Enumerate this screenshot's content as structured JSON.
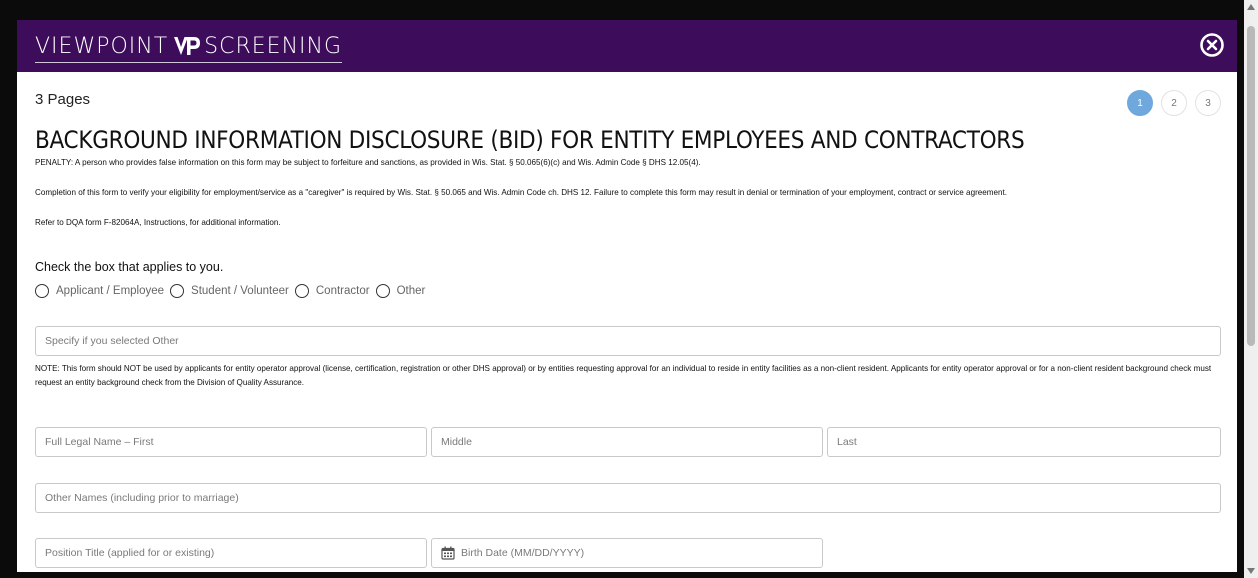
{
  "header": {
    "brand_left": "VIEWPOINT",
    "brand_right": "SCREENING",
    "logo_icon": "vp-logo-icon",
    "close_icon": "close-circle-icon",
    "colors": {
      "bar": "#3d0d5c",
      "active_page": "#6ea8dc"
    }
  },
  "form": {
    "pages_label": "3 Pages",
    "pagination": {
      "pages": [
        "1",
        "2",
        "3"
      ],
      "current": "1"
    },
    "title": "BACKGROUND INFORMATION DISCLOSURE (BID) FOR ENTITY EMPLOYEES AND CONTRACTORS",
    "penalty": "PENALTY: A person who provides false information on this form may be subject to forfeiture and sanctions, as provided in Wis. Stat. § 50.065(6)(c) and Wis. Admin Code § DHS 12.05(4).",
    "completion": "Completion of this form to verify your eligibility for employment/service as a \"caregiver\" is required by Wis. Stat. § 50.065 and Wis. Admin Code ch. DHS 12. Failure to complete this form may result in denial or termination of your employment, contract or service agreement.",
    "refer": "Refer to DQA form F-82064A, Instructions, for additional information.",
    "check_heading": "Check the box that applies to you.",
    "roles": [
      "Applicant / Employee",
      "Student / Volunteer",
      "Contractor",
      "Other"
    ],
    "specify_placeholder": "Specify if you selected Other",
    "note": "NOTE: This form should NOT be used by applicants for entity operator approval (license, certification, registration or other DHS approval) or by entities requesting approval for an individual to reside in entity facilities as a non-client resident. Applicants for entity operator approval or for a non-client resident background check must request an entity background check from the Division of Quality Assurance.",
    "first_name_placeholder": "Full Legal Name – First",
    "middle_name_placeholder": "Middle",
    "last_name_placeholder": "Last",
    "other_names_placeholder": "Other Names (including prior to marriage)",
    "position_placeholder": "Position Title (applied for or existing)",
    "birth_date_placeholder": "Birth Date (MM/DD/YYYY)",
    "calendar_icon": "calendar-icon"
  }
}
